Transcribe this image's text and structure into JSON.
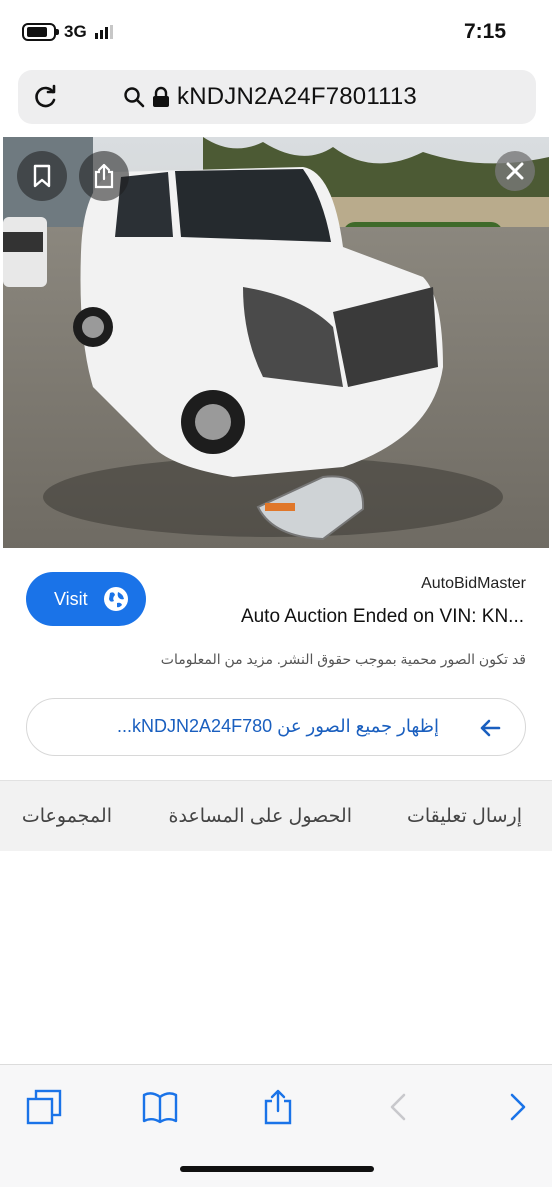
{
  "status_bar": {
    "network": "3G",
    "time": "7:15"
  },
  "address_bar": {
    "url": "kNDJN2A24F7801113"
  },
  "result": {
    "visit_label": "Visit",
    "source": "AutoBidMaster",
    "title": "Auto Auction Ended on VIN: KN...",
    "copyright_notice": "قد تكون الصور محمية بموجب حقوق النشر. مزيد من المعلومات",
    "show_all_images": "إظهار جميع الصور عن kNDJN2A24F780..."
  },
  "footer_links": {
    "send_feedback": "إرسال تعليقات",
    "get_help": "الحصول على المساعدة",
    "collections": "المجموعات"
  },
  "colors": {
    "accent": "#1a73e8",
    "link": "#1a5fbf"
  },
  "icons": [
    "reload-icon",
    "search-icon",
    "lock-icon",
    "bookmark-icon",
    "share-icon",
    "close-icon",
    "globe-icon",
    "arrow-left-icon",
    "tabs-icon",
    "bookmarks-icon",
    "back-icon",
    "forward-icon"
  ]
}
